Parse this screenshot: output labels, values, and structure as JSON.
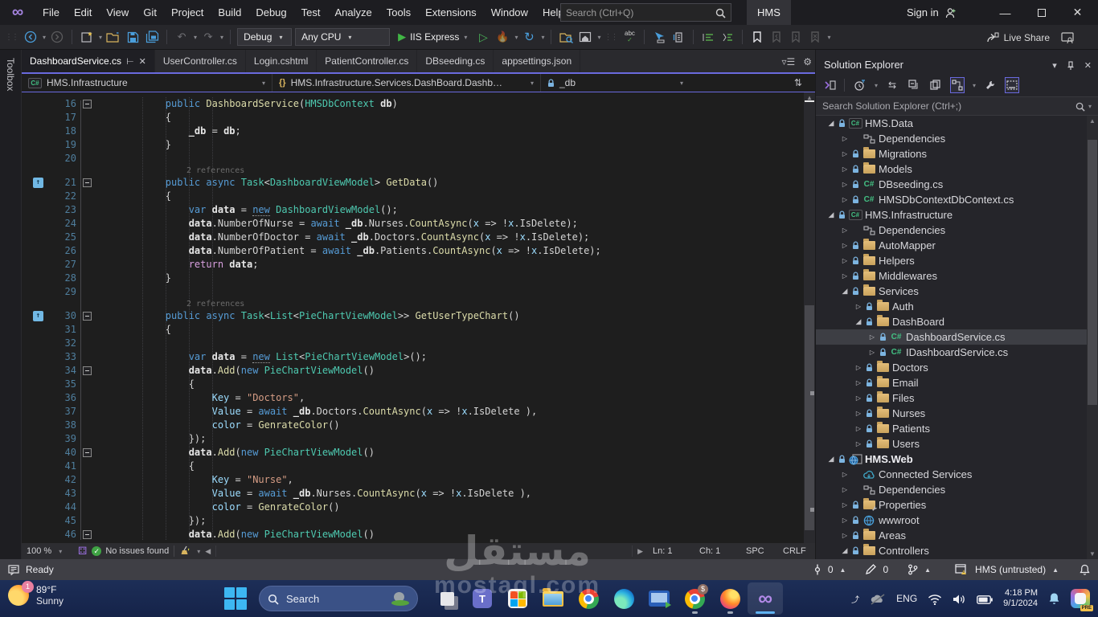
{
  "colors": {
    "accent": "#6a6ade",
    "editor_bg": "#1e1e1e",
    "status_bg": "#3f3f45",
    "taskbar_bg": "#1a2b52",
    "run_green": "#41b645"
  },
  "title_bar": {
    "menus": [
      "File",
      "Edit",
      "View",
      "Git",
      "Project",
      "Build",
      "Debug",
      "Test",
      "Analyze",
      "Tools",
      "Extensions",
      "Window",
      "Help"
    ],
    "search_placeholder": "Search (Ctrl+Q)",
    "project_badge": "HMS",
    "sign_in": "Sign in"
  },
  "toolbar": {
    "config": "Debug",
    "platform": "Any CPU",
    "run_label": "IIS Express",
    "live_share": "Live Share"
  },
  "editor": {
    "toolbox_label": "Toolbox",
    "tabs": [
      {
        "label": "DashboardService.cs",
        "active": true
      },
      {
        "label": "UserController.cs",
        "active": false
      },
      {
        "label": "Login.cshtml",
        "active": false
      },
      {
        "label": "PatientController.cs",
        "active": false
      },
      {
        "label": "DBseeding.cs",
        "active": false
      },
      {
        "label": "appsettings.json",
        "active": false
      }
    ],
    "breadcrumbs": {
      "project": "HMS.Infrastructure",
      "type": "HMS.Infrastructure.Services.DashBoard.DashboardSer",
      "member": "_db"
    },
    "codelens_text": "2 references",
    "code": [
      {
        "n": 16,
        "ind": 8,
        "fold": true,
        "tok": [
          [
            "kw",
            "public "
          ],
          [
            "m",
            "DashboardService"
          ],
          [
            "pl",
            "("
          ],
          [
            "ty",
            "HMSDbContext"
          ],
          [
            "pl",
            " "
          ],
          [
            "v",
            "db"
          ],
          [
            "pl",
            ")"
          ]
        ]
      },
      {
        "n": 17,
        "ind": 8,
        "tok": [
          [
            "pl",
            "{"
          ]
        ]
      },
      {
        "n": 18,
        "ind": 12,
        "tok": [
          [
            "v",
            "_db"
          ],
          [
            "pl",
            " = "
          ],
          [
            "v",
            "db"
          ],
          [
            "pl",
            ";"
          ]
        ]
      },
      {
        "n": 19,
        "ind": 8,
        "tok": [
          [
            "pl",
            "}"
          ]
        ]
      },
      {
        "n": 20,
        "ind": 0,
        "tok": []
      },
      {
        "lens": "2 references"
      },
      {
        "n": 21,
        "ind": 8,
        "fold": true,
        "badge": true,
        "tok": [
          [
            "kw",
            "public async "
          ],
          [
            "ty",
            "Task"
          ],
          [
            "pl",
            "<"
          ],
          [
            "ty",
            "DashboardViewModel"
          ],
          [
            "pl",
            "> "
          ],
          [
            "m",
            "GetData"
          ],
          [
            "pl",
            "()"
          ]
        ]
      },
      {
        "n": 22,
        "ind": 8,
        "tok": [
          [
            "pl",
            "{"
          ]
        ]
      },
      {
        "n": 23,
        "ind": 12,
        "tok": [
          [
            "kw",
            "var "
          ],
          [
            "v",
            "data"
          ],
          [
            "pl",
            " = "
          ],
          [
            "kw u",
            "new"
          ],
          [
            "pl",
            " "
          ],
          [
            "ty",
            "DashboardViewModel"
          ],
          [
            "pl",
            "();"
          ]
        ]
      },
      {
        "n": 24,
        "ind": 12,
        "tok": [
          [
            "v",
            "data"
          ],
          [
            "pl",
            ".NumberOfNurse = "
          ],
          [
            "kw",
            "await "
          ],
          [
            "v",
            "_db"
          ],
          [
            "pl",
            ".Nurses."
          ],
          [
            "m",
            "CountAsync"
          ],
          [
            "pl",
            "("
          ],
          [
            "p",
            "x"
          ],
          [
            "pl",
            " => !"
          ],
          [
            "p",
            "x"
          ],
          [
            "pl",
            ".IsDelete);"
          ]
        ]
      },
      {
        "n": 25,
        "ind": 12,
        "tok": [
          [
            "v",
            "data"
          ],
          [
            "pl",
            ".NumberOfDoctor = "
          ],
          [
            "kw",
            "await "
          ],
          [
            "v",
            "_db"
          ],
          [
            "pl",
            ".Doctors."
          ],
          [
            "m",
            "CountAsync"
          ],
          [
            "pl",
            "("
          ],
          [
            "p",
            "x"
          ],
          [
            "pl",
            " => !"
          ],
          [
            "p",
            "x"
          ],
          [
            "pl",
            ".IsDelete);"
          ]
        ]
      },
      {
        "n": 26,
        "ind": 12,
        "tok": [
          [
            "v",
            "data"
          ],
          [
            "pl",
            ".NumberOfPatient = "
          ],
          [
            "kw",
            "await "
          ],
          [
            "v",
            "_db"
          ],
          [
            "pl",
            ".Patients."
          ],
          [
            "m",
            "CountAsync"
          ],
          [
            "pl",
            "("
          ],
          [
            "p",
            "x"
          ],
          [
            "pl",
            " => !"
          ],
          [
            "p",
            "x"
          ],
          [
            "pl",
            ".IsDelete);"
          ]
        ]
      },
      {
        "n": 27,
        "ind": 12,
        "tok": [
          [
            "ct",
            "return "
          ],
          [
            "v",
            "data"
          ],
          [
            "pl",
            ";"
          ]
        ]
      },
      {
        "n": 28,
        "ind": 8,
        "tok": [
          [
            "pl",
            "}"
          ]
        ]
      },
      {
        "n": 29,
        "ind": 0,
        "tok": []
      },
      {
        "lens": "2 references"
      },
      {
        "n": 30,
        "ind": 8,
        "fold": true,
        "badge": true,
        "tok": [
          [
            "kw",
            "public async "
          ],
          [
            "ty",
            "Task"
          ],
          [
            "pl",
            "<"
          ],
          [
            "ty",
            "List"
          ],
          [
            "pl",
            "<"
          ],
          [
            "ty",
            "PieChartViewModel"
          ],
          [
            "pl",
            ">> "
          ],
          [
            "m",
            "GetUserTypeChart"
          ],
          [
            "pl",
            "()"
          ]
        ]
      },
      {
        "n": 31,
        "ind": 8,
        "tok": [
          [
            "pl",
            "{"
          ]
        ]
      },
      {
        "n": 32,
        "ind": 0,
        "tok": []
      },
      {
        "n": 33,
        "ind": 12,
        "tok": [
          [
            "kw",
            "var "
          ],
          [
            "v",
            "data"
          ],
          [
            "pl",
            " = "
          ],
          [
            "kw u",
            "new"
          ],
          [
            "pl",
            " "
          ],
          [
            "ty",
            "List"
          ],
          [
            "pl",
            "<"
          ],
          [
            "ty",
            "PieChartViewModel"
          ],
          [
            "pl",
            ">();"
          ]
        ]
      },
      {
        "n": 34,
        "ind": 12,
        "fold": true,
        "tok": [
          [
            "v",
            "data"
          ],
          [
            "pl",
            "."
          ],
          [
            "m",
            "Add"
          ],
          [
            "pl",
            "("
          ],
          [
            "kw",
            "new "
          ],
          [
            "ty",
            "PieChartViewModel"
          ],
          [
            "pl",
            "()"
          ]
        ]
      },
      {
        "n": 35,
        "ind": 12,
        "tok": [
          [
            "pl",
            "{"
          ]
        ]
      },
      {
        "n": 36,
        "ind": 16,
        "tok": [
          [
            "p",
            "Key"
          ],
          [
            "pl",
            " = "
          ],
          [
            "s",
            "\"Doctors\""
          ],
          [
            "pl",
            ","
          ]
        ]
      },
      {
        "n": 37,
        "ind": 16,
        "tok": [
          [
            "p",
            "Value"
          ],
          [
            "pl",
            " = "
          ],
          [
            "kw",
            "await "
          ],
          [
            "v",
            "_db"
          ],
          [
            "pl",
            ".Doctors."
          ],
          [
            "m",
            "CountAsync"
          ],
          [
            "pl",
            "("
          ],
          [
            "p",
            "x"
          ],
          [
            "pl",
            " => !"
          ],
          [
            "p",
            "x"
          ],
          [
            "pl",
            ".IsDelete ),"
          ]
        ]
      },
      {
        "n": 38,
        "ind": 16,
        "tok": [
          [
            "p",
            "color"
          ],
          [
            "pl",
            " = "
          ],
          [
            "m",
            "GenrateColor"
          ],
          [
            "pl",
            "()"
          ]
        ]
      },
      {
        "n": 39,
        "ind": 12,
        "tok": [
          [
            "pl",
            "});"
          ]
        ]
      },
      {
        "n": 40,
        "ind": 12,
        "fold": true,
        "tok": [
          [
            "v",
            "data"
          ],
          [
            "pl",
            "."
          ],
          [
            "m",
            "Add"
          ],
          [
            "pl",
            "("
          ],
          [
            "kw",
            "new "
          ],
          [
            "ty",
            "PieChartViewModel"
          ],
          [
            "pl",
            "()"
          ]
        ]
      },
      {
        "n": 41,
        "ind": 12,
        "tok": [
          [
            "pl",
            "{"
          ]
        ]
      },
      {
        "n": 42,
        "ind": 16,
        "tok": [
          [
            "p",
            "Key"
          ],
          [
            "pl",
            " = "
          ],
          [
            "s",
            "\"Nurse\""
          ],
          [
            "pl",
            ","
          ]
        ]
      },
      {
        "n": 43,
        "ind": 16,
        "tok": [
          [
            "p",
            "Value"
          ],
          [
            "pl",
            " = "
          ],
          [
            "kw",
            "await "
          ],
          [
            "v",
            "_db"
          ],
          [
            "pl",
            ".Nurses."
          ],
          [
            "m",
            "CountAsync"
          ],
          [
            "pl",
            "("
          ],
          [
            "p",
            "x"
          ],
          [
            "pl",
            " => !"
          ],
          [
            "p",
            "x"
          ],
          [
            "pl",
            ".IsDelete ),"
          ]
        ]
      },
      {
        "n": 44,
        "ind": 16,
        "tok": [
          [
            "p",
            "color"
          ],
          [
            "pl",
            " = "
          ],
          [
            "m",
            "GenrateColor"
          ],
          [
            "pl",
            "()"
          ]
        ]
      },
      {
        "n": 45,
        "ind": 12,
        "tok": [
          [
            "pl",
            "});"
          ]
        ]
      },
      {
        "n": 46,
        "ind": 12,
        "fold": true,
        "tok": [
          [
            "v",
            "data"
          ],
          [
            "pl",
            "."
          ],
          [
            "m",
            "Add"
          ],
          [
            "pl",
            "("
          ],
          [
            "kw",
            "new "
          ],
          [
            "ty",
            "PieChartViewModel"
          ],
          [
            "pl",
            "()"
          ]
        ]
      }
    ],
    "bottom_bar": {
      "zoom": "100 %",
      "issues": "No issues found",
      "ln": "Ln: 1",
      "ch": "Ch: 1",
      "spc": "SPC",
      "crlf": "CRLF"
    }
  },
  "solution_explorer": {
    "title": "Solution Explorer",
    "search_placeholder": "Search Solution Explorer (Ctrl+;)",
    "toolbar_icons": [
      "switch-views",
      "pending-changes-filter",
      "sync",
      "collapse-all",
      "show-all-files",
      "sync-with-active-document",
      "properties",
      "preview-selected-items"
    ],
    "tree": [
      {
        "lv": 0,
        "ex": "e",
        "lock": true,
        "icon": "csproj",
        "label": "HMS.Data"
      },
      {
        "lv": 1,
        "ex": "c",
        "icon": "dep",
        "label": "Dependencies"
      },
      {
        "lv": 1,
        "ex": "c",
        "lock": true,
        "icon": "folder",
        "label": "Migrations"
      },
      {
        "lv": 1,
        "ex": "c",
        "lock": true,
        "icon": "folder",
        "label": "Models"
      },
      {
        "lv": 1,
        "ex": "c",
        "lock": true,
        "icon": "cs",
        "label": "DBseeding.cs"
      },
      {
        "lv": 1,
        "ex": "c",
        "lock": true,
        "icon": "cs",
        "label": "HMSDbContextDbContext.cs"
      },
      {
        "lv": 0,
        "ex": "e",
        "lock": true,
        "icon": "csproj",
        "label": "HMS.Infrastructure"
      },
      {
        "lv": 1,
        "ex": "c",
        "icon": "dep",
        "label": "Dependencies"
      },
      {
        "lv": 1,
        "ex": "c",
        "lock": true,
        "icon": "folder",
        "label": "AutoMapper"
      },
      {
        "lv": 1,
        "ex": "c",
        "lock": true,
        "icon": "folder",
        "label": "Helpers"
      },
      {
        "lv": 1,
        "ex": "c",
        "lock": true,
        "icon": "folder",
        "label": "Middlewares"
      },
      {
        "lv": 1,
        "ex": "e",
        "lock": true,
        "icon": "folder",
        "label": "Services"
      },
      {
        "lv": 2,
        "ex": "c",
        "lock": true,
        "icon": "folder",
        "label": "Auth"
      },
      {
        "lv": 2,
        "ex": "e",
        "lock": true,
        "icon": "folder",
        "label": "DashBoard"
      },
      {
        "lv": 3,
        "ex": "c",
        "lock": true,
        "icon": "cs",
        "label": "DashboardService.cs",
        "selected": true
      },
      {
        "lv": 3,
        "ex": "c",
        "lock": true,
        "icon": "cs",
        "label": "IDashboardService.cs"
      },
      {
        "lv": 2,
        "ex": "c",
        "lock": true,
        "icon": "folder",
        "label": "Doctors"
      },
      {
        "lv": 2,
        "ex": "c",
        "lock": true,
        "icon": "folder",
        "label": "Email"
      },
      {
        "lv": 2,
        "ex": "c",
        "lock": true,
        "icon": "folder",
        "label": "Files"
      },
      {
        "lv": 2,
        "ex": "c",
        "lock": true,
        "icon": "folder",
        "label": "Nurses"
      },
      {
        "lv": 2,
        "ex": "c",
        "lock": true,
        "icon": "folder",
        "label": "Patients"
      },
      {
        "lv": 2,
        "ex": "c",
        "lock": true,
        "icon": "folder",
        "label": "Users"
      },
      {
        "lv": 0,
        "ex": "e",
        "lock": true,
        "icon": "web",
        "label": "HMS.Web",
        "bold": true
      },
      {
        "lv": 1,
        "ex": "c",
        "icon": "cloud",
        "label": "Connected Services"
      },
      {
        "lv": 1,
        "ex": "c",
        "icon": "dep",
        "label": "Dependencies"
      },
      {
        "lv": 1,
        "ex": "c",
        "lock": true,
        "icon": "propfolder",
        "label": "Properties"
      },
      {
        "lv": 1,
        "ex": "c",
        "lock": true,
        "icon": "globe",
        "label": "wwwroot"
      },
      {
        "lv": 1,
        "ex": "c",
        "lock": true,
        "icon": "folder",
        "label": "Areas"
      },
      {
        "lv": 1,
        "ex": "e",
        "lock": true,
        "icon": "folder",
        "label": "Controllers"
      }
    ]
  },
  "status_bar": {
    "ready": "Ready",
    "commit_count": "0",
    "edit_count": "0",
    "repo_label": "HMS (untrusted)"
  },
  "taskbar": {
    "weather_temp": "89°F",
    "weather_cond": "Sunny",
    "weather_badge": "1",
    "search_label": "Search",
    "app_icons": [
      "task-view",
      "teams",
      "store",
      "file-explorer",
      "chrome",
      "edge",
      "remote-desktop",
      "chrome-work",
      "firefox",
      "visual-studio"
    ],
    "tray": {
      "language": "ENG",
      "time": "4:18 PM",
      "date": "9/1/2024",
      "copilot_badge": "PRE"
    }
  },
  "watermark": {
    "line1": "مستقل",
    "line2": "mostaql.com"
  }
}
